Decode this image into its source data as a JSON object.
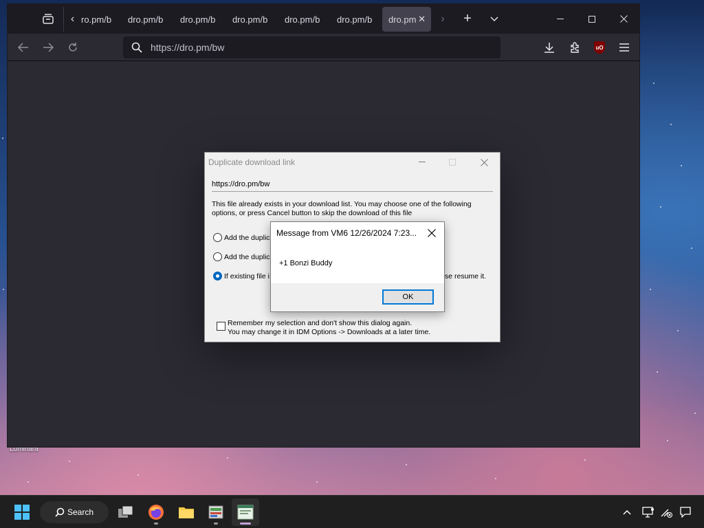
{
  "wallpaper": {
    "label": "Luminara"
  },
  "browser": {
    "tabs": [
      {
        "label": "ro.pm/b"
      },
      {
        "label": "dro.pm/b"
      },
      {
        "label": "dro.pm/b"
      },
      {
        "label": "dro.pm/b"
      },
      {
        "label": "dro.pm/b"
      },
      {
        "label": "dro.pm/b"
      },
      {
        "label": "dro.pm",
        "active": true
      }
    ],
    "url": "https://dro.pm/bw"
  },
  "idm_dialog": {
    "title": "Duplicate download link",
    "url": "https://dro.pm/bw",
    "description": "This file already exists in your download list. You may choose one of the following options, or press Cancel button to skip the download of this file",
    "options": [
      {
        "label": "Add the duplic",
        "checked": false
      },
      {
        "label": "Add the duplic",
        "checked": false
      },
      {
        "label": "If existing file i",
        "tail": "se resume it.",
        "checked": true
      }
    ],
    "remember_line1": "Remember my selection and don't show this dialog again.",
    "remember_line2": "You may change it in IDM Options -> Downloads at a later time."
  },
  "message_box": {
    "title": "Message from VM6 12/26/2024 7:23...",
    "message": "+1 Bonzi Buddy",
    "ok_label": "OK"
  },
  "taskbar": {
    "search_label": "Search"
  },
  "colors": {
    "accent": "#0078d7",
    "browser_bg": "#2b2a33",
    "tabbar_bg": "#1c1b22"
  }
}
